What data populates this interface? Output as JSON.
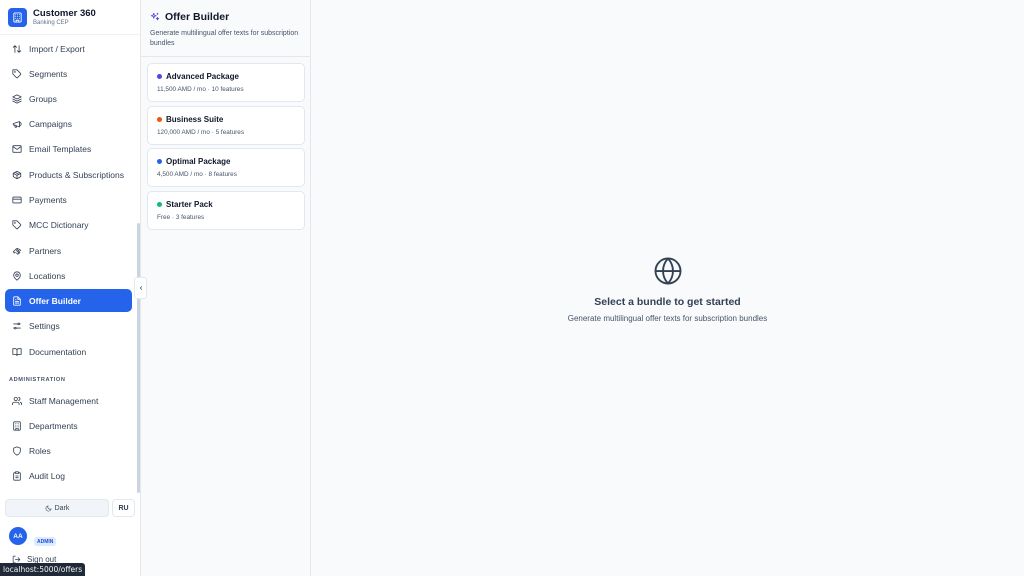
{
  "brand": {
    "title": "Customer 360",
    "subtitle": "Banking CEP"
  },
  "nav": [
    {
      "label": "Import / Export",
      "icon": "arrows-updown-icon"
    },
    {
      "label": "Segments",
      "icon": "tag-icon"
    },
    {
      "label": "Groups",
      "icon": "layers-icon"
    },
    {
      "label": "Campaigns",
      "icon": "megaphone-icon"
    },
    {
      "label": "Email Templates",
      "icon": "mail-icon"
    },
    {
      "label": "Products & Subscriptions",
      "icon": "package-icon"
    },
    {
      "label": "Payments",
      "icon": "credit-card-icon"
    },
    {
      "label": "MCC Dictionary",
      "icon": "tag-icon"
    },
    {
      "label": "Partners",
      "icon": "handshake-icon"
    },
    {
      "label": "Locations",
      "icon": "map-pin-icon"
    },
    {
      "label": "Offer Builder",
      "icon": "file-text-icon",
      "active": true
    },
    {
      "label": "Settings",
      "icon": "sliders-icon"
    },
    {
      "label": "Documentation",
      "icon": "book-icon"
    }
  ],
  "admin_section": {
    "label": "ADMINISTRATION",
    "items": [
      {
        "label": "Staff Management",
        "icon": "users-icon"
      },
      {
        "label": "Departments",
        "icon": "building-icon"
      },
      {
        "label": "Roles",
        "icon": "shield-icon"
      },
      {
        "label": "Audit Log",
        "icon": "clipboard-icon"
      }
    ]
  },
  "footer": {
    "theme_label": "Dark",
    "lang_label": "RU",
    "avatar_initials": "AA",
    "role_badge": "ADMIN",
    "sign_out": "Sign out"
  },
  "status_url": "localhost:5000/offers",
  "panel": {
    "title": "Offer Builder",
    "description": "Generate multilingual offer texts for subscription bundles"
  },
  "bundles": [
    {
      "name": "Advanced Package",
      "meta": "11,500 AMD / mo · 10 features",
      "color": "#4f46e5"
    },
    {
      "name": "Business Suite",
      "meta": "120,000 AMD / mo · 5 features",
      "color": "#ea580c"
    },
    {
      "name": "Optimal Package",
      "meta": "4,500 AMD / mo · 8 features",
      "color": "#2563eb"
    },
    {
      "name": "Starter Pack",
      "meta": "Free · 3 features",
      "color": "#10b981"
    }
  ],
  "empty_state": {
    "title": "Select a bundle to get started",
    "description": "Generate multilingual offer texts for subscription bundles",
    "icon": "globe-icon"
  },
  "colors": {
    "accent": "#2563eb",
    "sidebar_bg": "#ffffff",
    "page_bg": "#f8fafc"
  }
}
